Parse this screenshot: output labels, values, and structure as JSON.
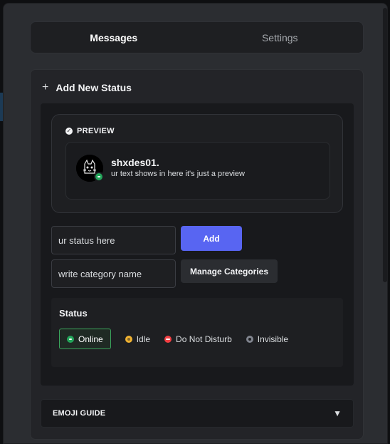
{
  "tabs": [
    {
      "label": "Messages",
      "active": true
    },
    {
      "label": "Settings",
      "active": false
    }
  ],
  "add_section": {
    "plus": "+",
    "title": "Add New Status"
  },
  "preview": {
    "title": "PREVIEW",
    "check": "✓",
    "username": "shxdes01.",
    "text": "ur text shows in here it's just a preview"
  },
  "form": {
    "status_input": {
      "value": "ur status here"
    },
    "category_input": {
      "value": "write category name"
    },
    "add_button": "Add",
    "manage_button": "Manage Categories"
  },
  "status": {
    "label": "Status",
    "options": [
      {
        "label": "Online",
        "color": "#23a55a",
        "selected": true
      },
      {
        "label": "Idle",
        "color": "#f0b232",
        "selected": false
      },
      {
        "label": "Do Not Disturb",
        "color": "#f23f43",
        "selected": false
      },
      {
        "label": "Invisible",
        "color": "#80848e",
        "selected": false
      }
    ]
  },
  "emoji_guide": {
    "title": "EMOJI GUIDE",
    "caret": "▼"
  }
}
